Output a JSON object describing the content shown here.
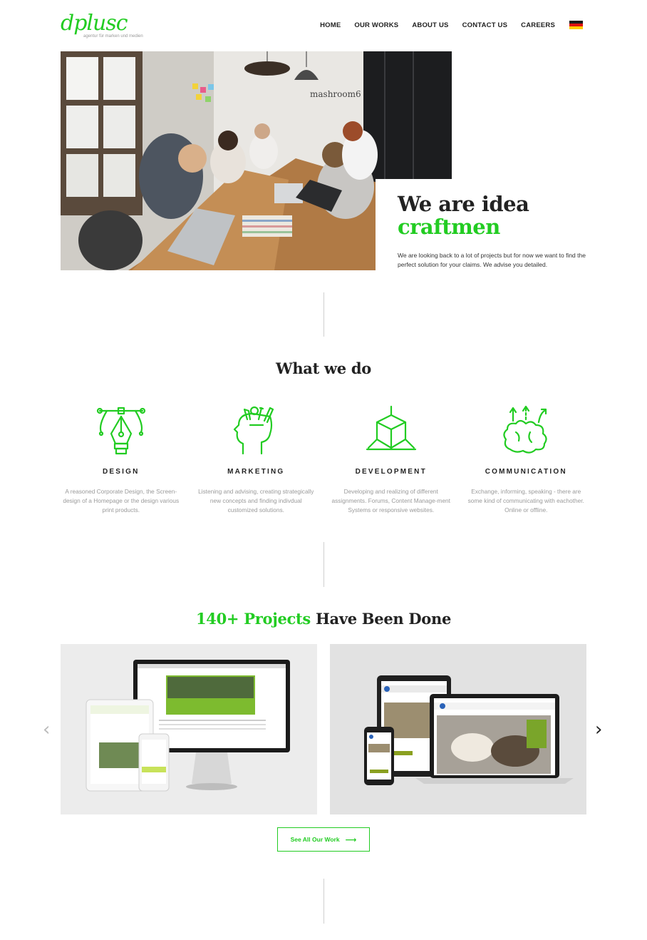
{
  "header": {
    "logo_text": "dplusc",
    "logo_tagline": "agentur für marken und medien",
    "nav": [
      "HOME",
      "OUR WORKS",
      "ABOUT US",
      "CONTACT US",
      "CAREERS"
    ],
    "flag_icon": "german-flag-icon"
  },
  "hero": {
    "photo_sign": "mashroom6",
    "title_line1": "We are idea",
    "title_line2": "craftmen",
    "text": "We are looking back to a lot of projects but for now we want to find the perfect solution for your claims. We advise you detailed."
  },
  "services": {
    "title": "What we do",
    "items": [
      {
        "icon": "pen-tool-icon",
        "title": "DESIGN",
        "text": "A reasoned Corporate Design, the Screen-design of a Homepage or the design various print products."
      },
      {
        "icon": "head-with-pencils-icon",
        "title": "MARKETING",
        "text": "Listening and advising, creating strategically new concepts and finding indivdual customized solutions."
      },
      {
        "icon": "cube-icon",
        "title": "DEVELOPMENT",
        "text": "Developing and realizing of different assignments. Forums, Content Manage-ment Systems or responsive websites."
      },
      {
        "icon": "brain-arrows-icon",
        "title": "COMMUNICATION",
        "text": "Exchange, informing, speaking - there are some kind of communicating with eachother. Online or offline."
      }
    ]
  },
  "projects": {
    "title_highlight": "140+ Projects",
    "title_rest": "Have Been Done",
    "prev_arrow": "‹",
    "next_arrow": "›",
    "button_label": "See All Our Work",
    "button_arrow": "⟶"
  },
  "colors": {
    "accent": "#22cc22",
    "text_dark": "#222222",
    "text_muted": "#9a9a9a",
    "divider": "#cfcfcf"
  }
}
